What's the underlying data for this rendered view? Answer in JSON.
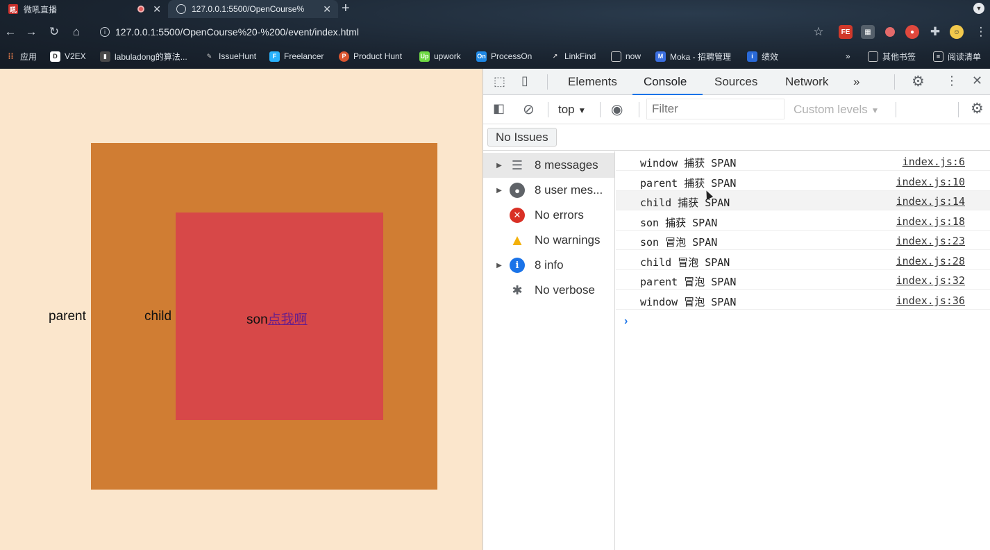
{
  "browser": {
    "tabs": [
      {
        "title": "微吼直播",
        "icon": "weihou-icon"
      },
      {
        "title": "127.0.0.1:5500/OpenCourse%",
        "icon": "globe-icon"
      }
    ],
    "url_host": "127.0.0.1",
    "url_rest": ":5500/OpenCourse%20-%200/event/index.html",
    "bookmarks": [
      {
        "label": "应用",
        "icon": "apps-grid-icon"
      },
      {
        "label": "V2EX",
        "icon": "v2ex-icon"
      },
      {
        "label": "labuladong的算法...",
        "icon": "book-icon"
      },
      {
        "label": "IssueHunt",
        "icon": "issuehunt-icon"
      },
      {
        "label": "Freelancer",
        "icon": "freelancer-icon"
      },
      {
        "label": "Product Hunt",
        "icon": "producthunt-icon"
      },
      {
        "label": "upwork",
        "icon": "upwork-icon"
      },
      {
        "label": "ProcessOn",
        "icon": "processon-icon"
      },
      {
        "label": "LinkFind",
        "icon": "linkfind-icon"
      },
      {
        "label": "now",
        "icon": "folder-icon"
      },
      {
        "label": "Moka - 招聘管理",
        "icon": "moka-icon"
      },
      {
        "label": "绩效",
        "icon": "jixiao-icon"
      }
    ],
    "bookmarks_overflow": "»",
    "other_bookmarks": "其他书签",
    "reading_list": "阅读清单",
    "colors": {
      "accent": "#1a73e8"
    }
  },
  "page": {
    "parent_label": "parent",
    "child_label": "child",
    "son_label": "son",
    "son_link": "点我啊",
    "colors": {
      "background": "#fbe6cc",
      "parent": "#d07d33",
      "son": "#d74848"
    }
  },
  "devtools": {
    "tabs": [
      "Elements",
      "Console",
      "Sources",
      "Network"
    ],
    "active_tab": "Console",
    "more_tabs": "»",
    "context": "top",
    "filter_placeholder": "Filter",
    "levels": "Custom levels",
    "no_issues": "No Issues",
    "sidebar": [
      {
        "label": "8 messages",
        "icon": "list-icon",
        "expandable": true
      },
      {
        "label": "8 user mes...",
        "icon": "user-icon",
        "expandable": true
      },
      {
        "label": "No errors",
        "icon": "error-icon",
        "expandable": false
      },
      {
        "label": "No warnings",
        "icon": "warning-icon",
        "expandable": false
      },
      {
        "label": "8 info",
        "icon": "info-icon",
        "expandable": true
      },
      {
        "label": "No verbose",
        "icon": "bug-icon",
        "expandable": false
      }
    ],
    "logs": [
      {
        "message": "window 捕获 SPAN",
        "source": "index.js:6"
      },
      {
        "message": "parent 捕获 SPAN",
        "source": "index.js:10"
      },
      {
        "message": "child 捕获 SPAN",
        "source": "index.js:14"
      },
      {
        "message": "son 捕获 SPAN",
        "source": "index.js:18"
      },
      {
        "message": "son 冒泡 SPAN",
        "source": "index.js:23"
      },
      {
        "message": "child 冒泡 SPAN",
        "source": "index.js:28"
      },
      {
        "message": "parent 冒泡 SPAN",
        "source": "index.js:32"
      },
      {
        "message": "window 冒泡 SPAN",
        "source": "index.js:36"
      }
    ],
    "prompt": "›"
  }
}
